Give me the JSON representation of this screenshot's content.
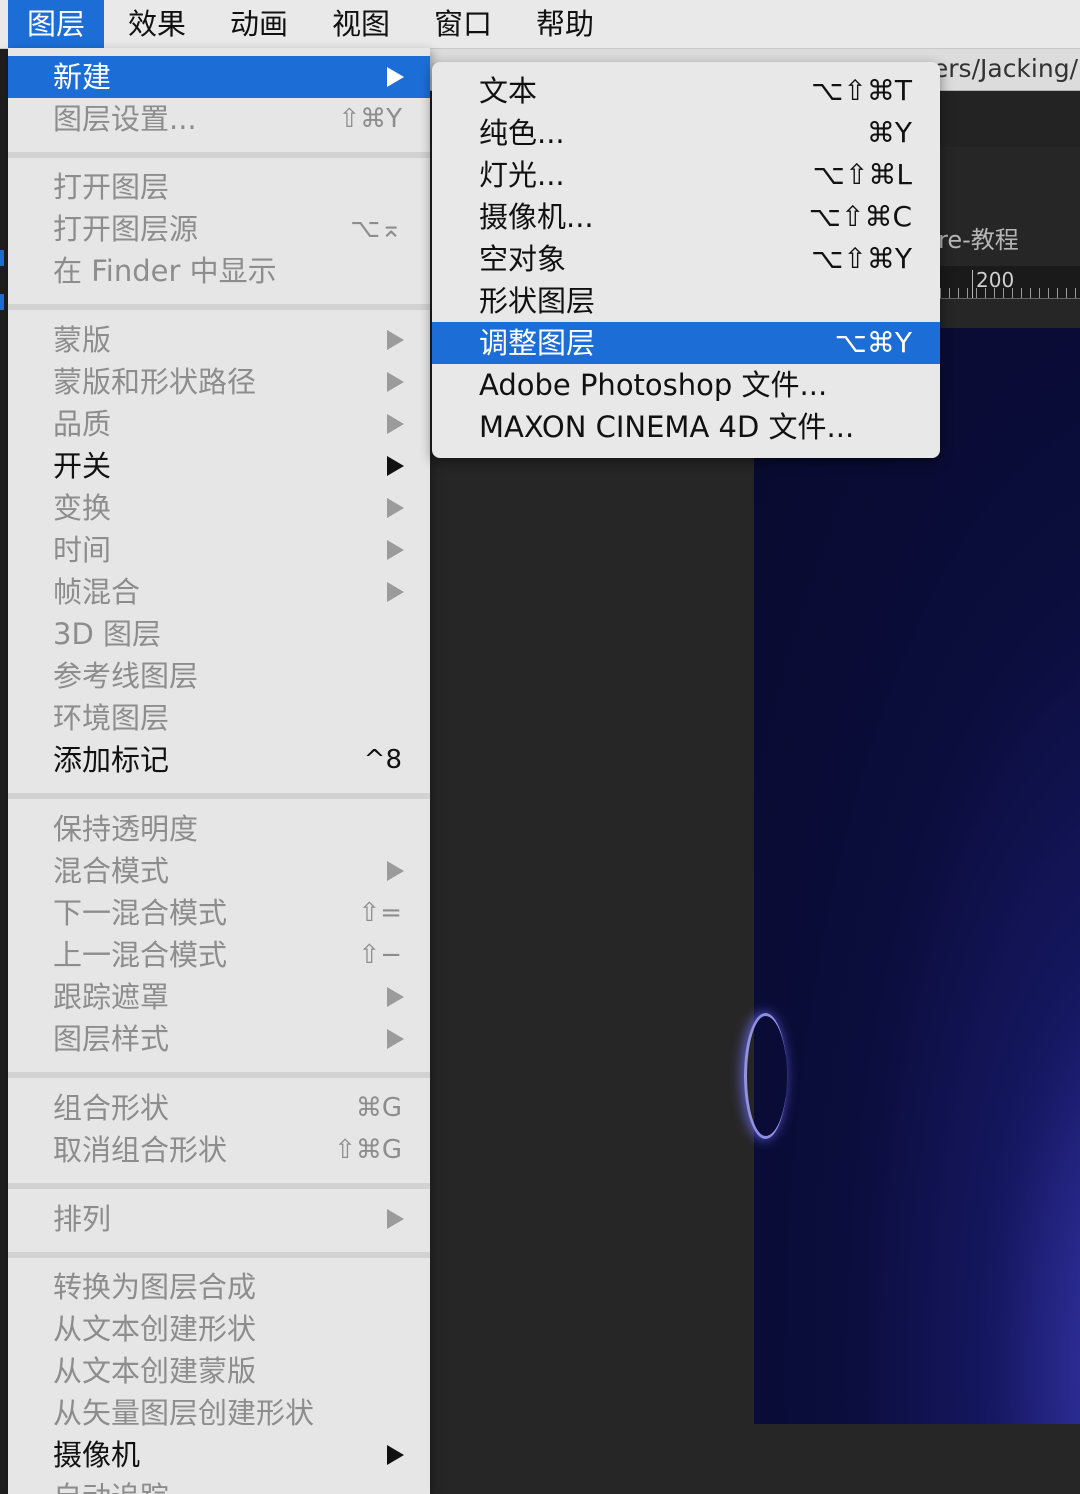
{
  "menubar": {
    "items": [
      "图层",
      "效果",
      "动画",
      "视图",
      "窗口",
      "帮助"
    ],
    "active_index": 0
  },
  "app": {
    "title_fragment": "ers/Jacking/",
    "comp_tab_fragment": "re-教程",
    "ruler_label": "200"
  },
  "layer_menu": [
    {
      "label": "新建",
      "shortcut": "",
      "submenu": true,
      "enabled": true,
      "highlighted": true
    },
    {
      "label": "图层设置...",
      "shortcut": "⇧⌘Y",
      "submenu": false,
      "enabled": false
    },
    {
      "label": "打开图层",
      "shortcut": "",
      "submenu": false,
      "enabled": false
    },
    {
      "label": "打开图层源",
      "shortcut": "⌥⌅",
      "submenu": false,
      "enabled": false
    },
    {
      "label": "在 Finder 中显示",
      "shortcut": "",
      "submenu": false,
      "enabled": false
    },
    {
      "label": "蒙版",
      "shortcut": "",
      "submenu": true,
      "enabled": false
    },
    {
      "label": "蒙版和形状路径",
      "shortcut": "",
      "submenu": true,
      "enabled": false
    },
    {
      "label": "品质",
      "shortcut": "",
      "submenu": true,
      "enabled": false
    },
    {
      "label": "开关",
      "shortcut": "",
      "submenu": true,
      "enabled": true
    },
    {
      "label": "变换",
      "shortcut": "",
      "submenu": true,
      "enabled": false
    },
    {
      "label": "时间",
      "shortcut": "",
      "submenu": true,
      "enabled": false
    },
    {
      "label": "帧混合",
      "shortcut": "",
      "submenu": true,
      "enabled": false
    },
    {
      "label": "3D 图层",
      "shortcut": "",
      "submenu": false,
      "enabled": false
    },
    {
      "label": "参考线图层",
      "shortcut": "",
      "submenu": false,
      "enabled": false
    },
    {
      "label": "环境图层",
      "shortcut": "",
      "submenu": false,
      "enabled": false
    },
    {
      "label": "添加标记",
      "shortcut": "^8",
      "submenu": false,
      "enabled": true
    },
    {
      "label": "保持透明度",
      "shortcut": "",
      "submenu": false,
      "enabled": false
    },
    {
      "label": "混合模式",
      "shortcut": "",
      "submenu": true,
      "enabled": false
    },
    {
      "label": "下一混合模式",
      "shortcut": "⇧=",
      "submenu": false,
      "enabled": false
    },
    {
      "label": "上一混合模式",
      "shortcut": "⇧−",
      "submenu": false,
      "enabled": false
    },
    {
      "label": "跟踪遮罩",
      "shortcut": "",
      "submenu": true,
      "enabled": false
    },
    {
      "label": "图层样式",
      "shortcut": "",
      "submenu": true,
      "enabled": false
    },
    {
      "label": "组合形状",
      "shortcut": "⌘G",
      "submenu": false,
      "enabled": false
    },
    {
      "label": "取消组合形状",
      "shortcut": "⇧⌘G",
      "submenu": false,
      "enabled": false
    },
    {
      "label": "排列",
      "shortcut": "",
      "submenu": true,
      "enabled": false
    },
    {
      "label": "转换为图层合成",
      "shortcut": "",
      "submenu": false,
      "enabled": false
    },
    {
      "label": "从文本创建形状",
      "shortcut": "",
      "submenu": false,
      "enabled": false
    },
    {
      "label": "从文本创建蒙版",
      "shortcut": "",
      "submenu": false,
      "enabled": false
    },
    {
      "label": "从矢量图层创建形状",
      "shortcut": "",
      "submenu": false,
      "enabled": false
    },
    {
      "label": "摄像机",
      "shortcut": "",
      "submenu": true,
      "enabled": true
    },
    {
      "label": "自动追踪",
      "shortcut": "",
      "submenu": false,
      "enabled": false
    }
  ],
  "new_submenu": [
    {
      "label": "文本",
      "shortcut": "⌥⇧⌘T",
      "highlighted": false
    },
    {
      "label": "纯色...",
      "shortcut": "⌘Y",
      "highlighted": false
    },
    {
      "label": "灯光...",
      "shortcut": "⌥⇧⌘L",
      "highlighted": false
    },
    {
      "label": "摄像机...",
      "shortcut": "⌥⇧⌘C",
      "highlighted": false
    },
    {
      "label": "空对象",
      "shortcut": "⌥⇧⌘Y",
      "highlighted": false
    },
    {
      "label": "形状图层",
      "shortcut": "",
      "highlighted": false
    },
    {
      "label": "调整图层",
      "shortcut": "⌥⌘Y",
      "highlighted": true
    },
    {
      "label": "Adobe Photoshop 文件...",
      "shortcut": "",
      "highlighted": false
    },
    {
      "label": "MAXON CINEMA 4D 文件...",
      "shortcut": "",
      "highlighted": false
    }
  ],
  "colors": {
    "highlight": "#1c6ed6",
    "menu_bg": "#e6e6e6",
    "disabled_text": "#8d8d8d"
  }
}
